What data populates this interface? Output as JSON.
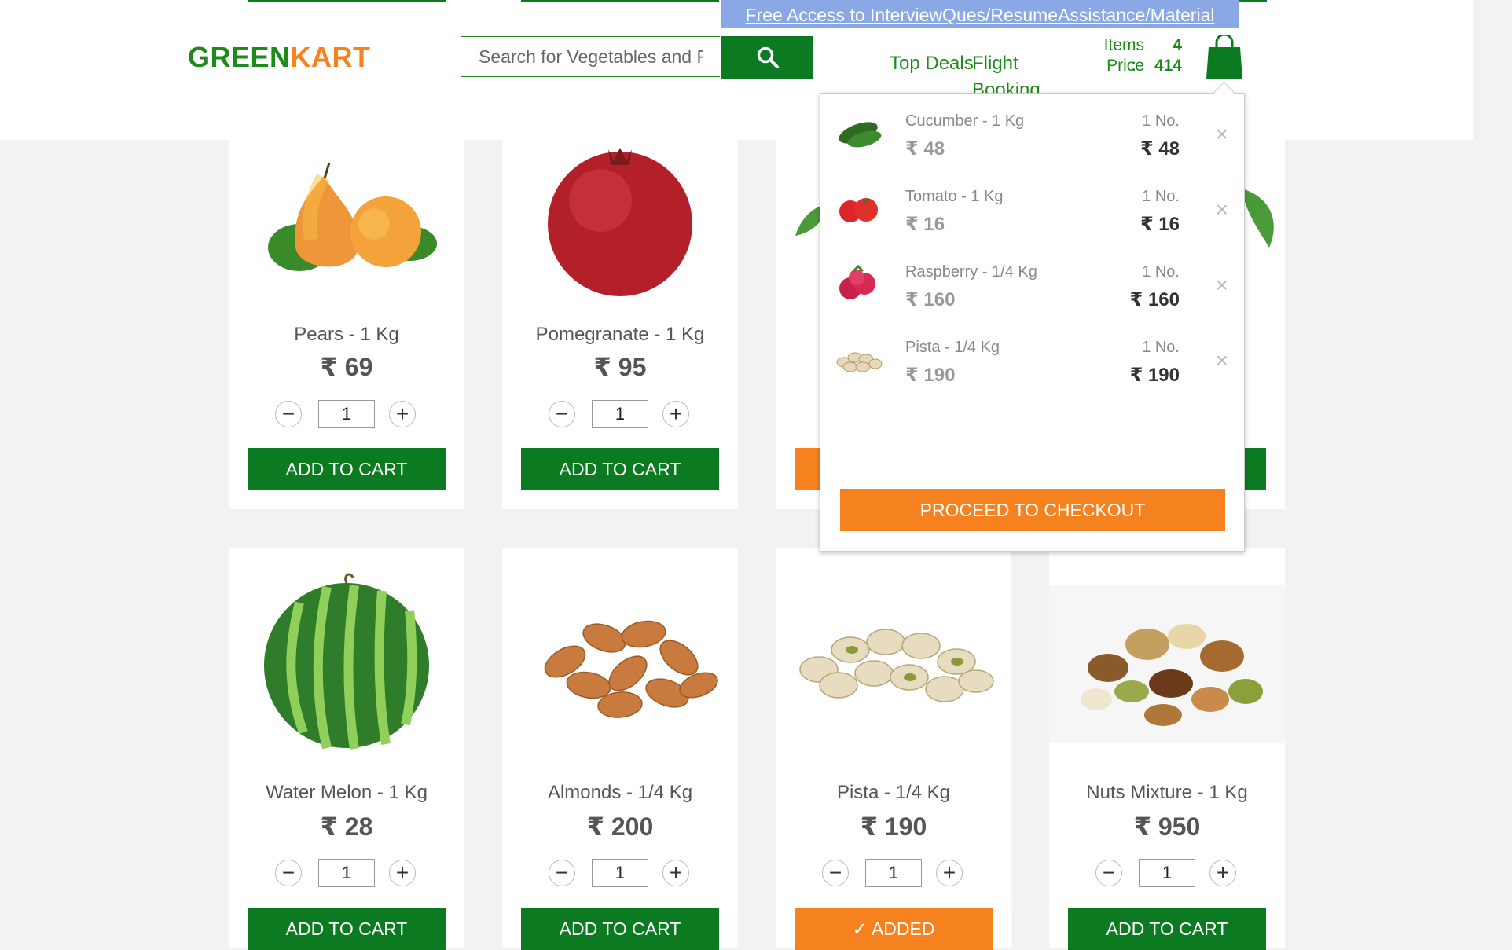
{
  "header": {
    "promo_link": "Free Access to InterviewQues/ResumeAssistance/Material",
    "logo_part1": "GREEN",
    "logo_part2": "KART",
    "search_placeholder": "Search for Vegetables and Fruits",
    "nav": {
      "top_deals": "Top Deals",
      "flight_booking": "Flight Booking"
    },
    "summary": {
      "items_label": "Items",
      "items_value": "4",
      "price_label": "Price",
      "price_value": "414",
      "colon": ":"
    }
  },
  "products": [
    {
      "name": "Pears - 1 Kg",
      "price": "₹ 69",
      "qty": "1",
      "button": "ADD TO CART"
    },
    {
      "name": "Pomegranate - 1 Kg",
      "price": "₹ 95",
      "qty": "1",
      "button": "ADD TO CART"
    },
    {
      "name": "Water Melon - 1 Kg",
      "price": "₹ 28",
      "qty": "1",
      "button": "ADD TO CART"
    },
    {
      "name": "Almonds - 1/4 Kg",
      "price": "₹ 200",
      "qty": "1",
      "button": "ADD TO CART"
    },
    {
      "name": "Pista - 1/4 Kg",
      "price": "₹ 190",
      "qty": "1",
      "button": "✓ ADDED"
    },
    {
      "name": "Nuts Mixture - 1 Kg",
      "price": "₹ 950",
      "qty": "1",
      "button": "ADD TO CART"
    }
  ],
  "cart": {
    "items": [
      {
        "name": "Cucumber - 1 Kg",
        "price": "₹ 48",
        "qty": "1 No.",
        "amount": "₹ 48"
      },
      {
        "name": "Tomato - 1 Kg",
        "price": "₹ 16",
        "qty": "1 No.",
        "amount": "₹ 16"
      },
      {
        "name": "Raspberry - 1/4 Kg",
        "price": "₹ 160",
        "qty": "1 No.",
        "amount": "₹ 160"
      },
      {
        "name": "Pista - 1/4 Kg",
        "price": "₹ 190",
        "qty": "1 No.",
        "amount": "₹ 190"
      }
    ],
    "remove_symbol": "×",
    "checkout_label": "PROCEED TO CHECKOUT"
  },
  "stepper": {
    "minus": "−",
    "plus": "+"
  },
  "colors": {
    "brand_green": "#0b7a20",
    "brand_orange": "#f6821f",
    "promo_bg": "#8aa8e6"
  },
  "icons": [
    "search-icon",
    "cart-icon"
  ]
}
